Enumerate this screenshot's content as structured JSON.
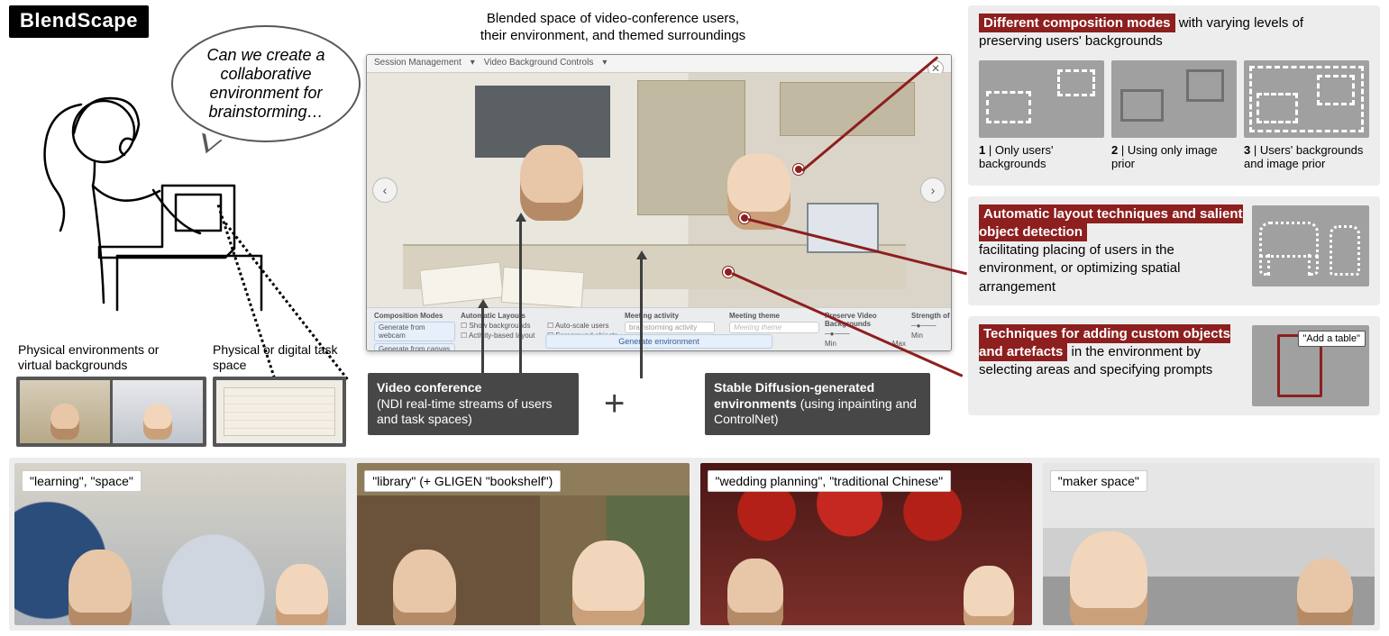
{
  "title": "BlendScape",
  "speech_bubble": "Can we create a collaborative environment for brainstorming…",
  "top_caption": "Blended space of video-conference users,\ntheir environment, and themed surroundings",
  "video_panel": {
    "toolbar": {
      "tab1": "Session Management",
      "tab2": "Video Background Controls"
    },
    "controls": {
      "comp_hdr": "Composition Modes",
      "gen_webcam": "Generate from webcam",
      "gen_canvas": "Generate from canvas",
      "auto_hdr": "Automatic Layouts",
      "show_bg": "Show backgrounds",
      "activity_lay": "Activity-based layout",
      "auto_scale": "Auto-scale users",
      "fg_objects": "Foreground objects",
      "activity_hdr": "Meeting activity",
      "activity_val": "brainstorming activity",
      "theme_hdr": "Meeting theme",
      "theme_ph": "Meeting theme",
      "preserve_hdr": "Preserve Video Backgrounds",
      "strength_hdr": "Strength of Stylization",
      "min": "Min",
      "max": "Max",
      "gen_env": "Generate environment"
    }
  },
  "left_labels": {
    "env_label": "Physical environments or virtual backgrounds",
    "task_label": "Physical or digital task space"
  },
  "darkbox1": {
    "bold": "Video conference",
    "rest": "(NDI real-time streams of users and task spaces)"
  },
  "darkbox2": {
    "bold": "Stable Diffusion-generated environments",
    "rest": "(using inpainting and ControlNet)"
  },
  "right": {
    "sec1_pill": "Different composition modes",
    "sec1_rest": " with varying levels of preserving users' backgrounds",
    "mode1": {
      "num": "1",
      "bar": " | ",
      "text": "Only users' backgrounds"
    },
    "mode2": {
      "num": "2",
      "bar": " | ",
      "text": "Using only image prior"
    },
    "mode3": {
      "num": "3",
      "bar": " | ",
      "text": "Users' backgrounds and image prior"
    },
    "sec2_pill": "Automatic layout techniques and salient object detection",
    "sec2_rest": "facilitating placing of users in the environment, or optimizing spatial arrangement",
    "sec3_pill": "Techniques for adding custom objects and artefacts",
    "sec3_rest": " in the environment by selecting areas and specifying prompts",
    "add_label": "\"Add a table\""
  },
  "examples": {
    "e1": "\"learning\", \"space\"",
    "e2": "\"library\" (+ GLIGEN \"bookshelf\")",
    "e3": "\"wedding planning\", \"traditional Chinese\"",
    "e4": "\"maker space\""
  }
}
